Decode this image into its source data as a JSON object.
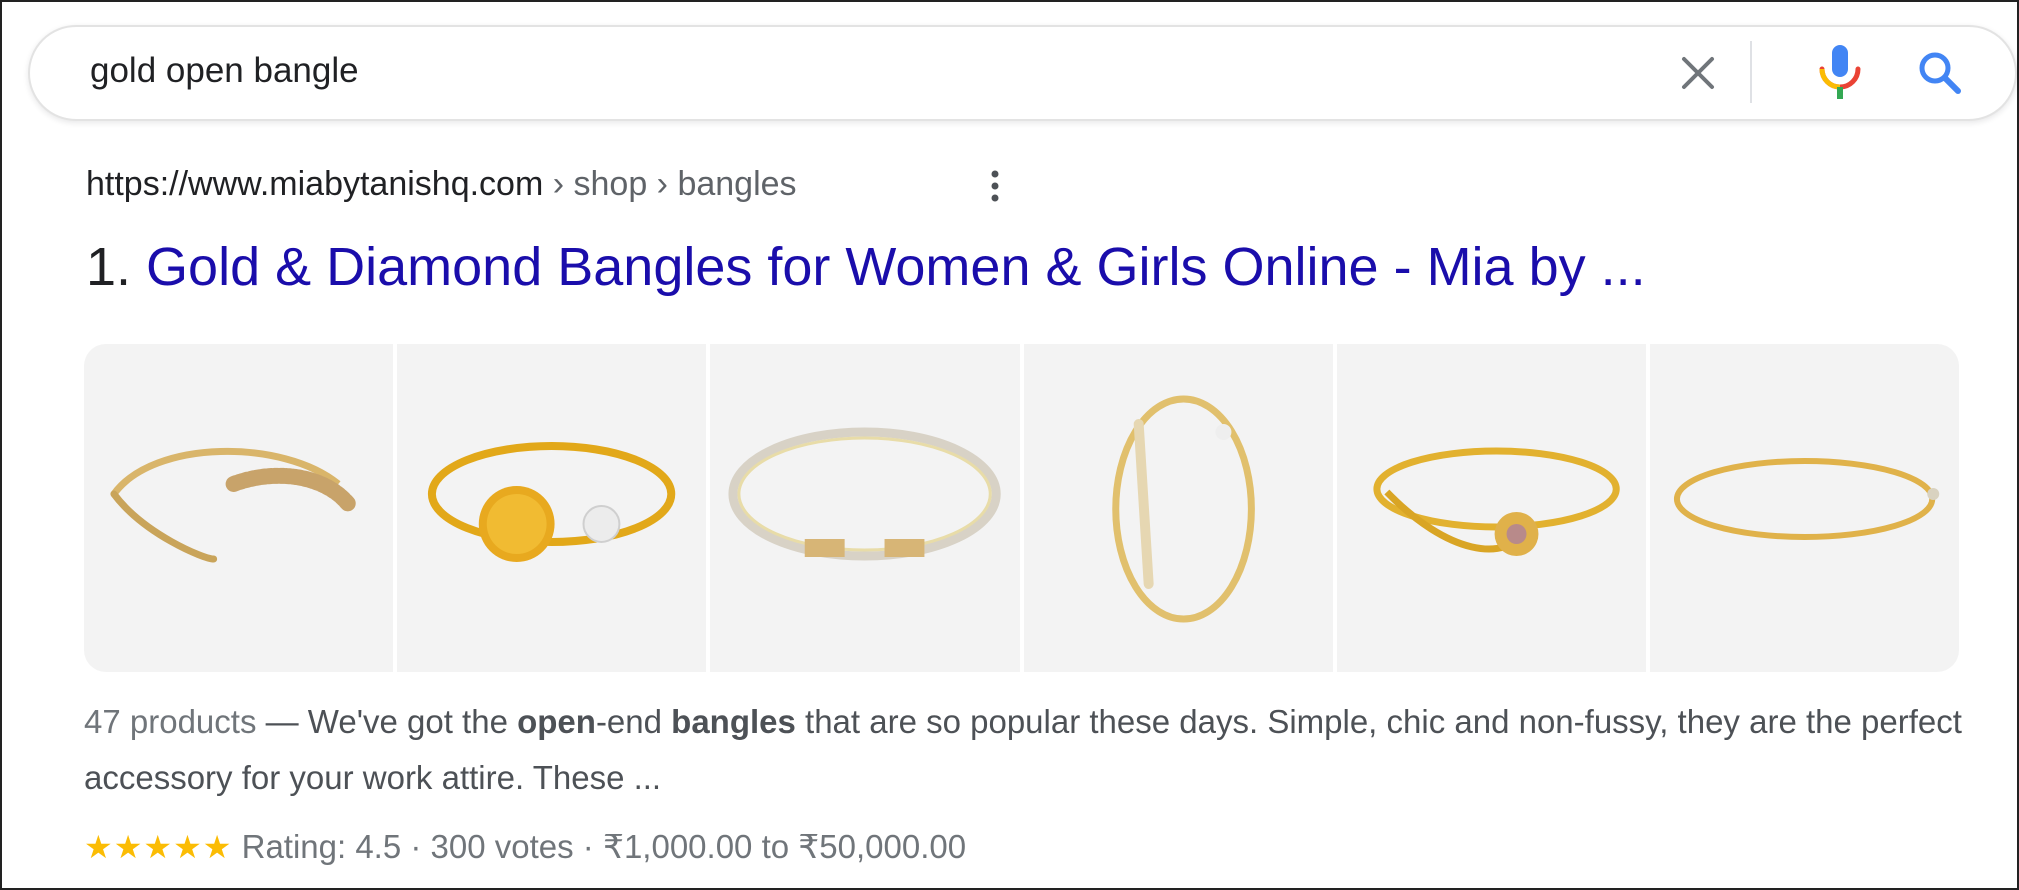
{
  "search": {
    "query": "gold open bangle"
  },
  "icons": {
    "clear": "close-icon",
    "mic": "microphone-icon",
    "search": "search-icon",
    "more": "more-vert-icon",
    "star": "star-icon"
  },
  "colors": {
    "link": "#1a0dab",
    "star": "#fbbc04",
    "search_blue": "#4285f4",
    "mic_red": "#ea4335",
    "mic_blue": "#4285f4",
    "mic_yellow": "#fbbc04",
    "mic_green": "#34a853"
  },
  "result": {
    "url_domain": "https://www.miabytanishq.com",
    "url_crumbs": " › shop › bangles",
    "number": "1. ",
    "title": "Gold & Diamond Bangles for Women & Girls Online - Mia by ...",
    "images": [
      {
        "name": "product-image-1"
      },
      {
        "name": "product-image-2"
      },
      {
        "name": "product-image-3"
      },
      {
        "name": "product-image-4"
      },
      {
        "name": "product-image-5"
      },
      {
        "name": "product-image-6"
      }
    ],
    "snippet_meta": "47 products",
    "snippet_dash": " — We've got the ",
    "snippet_bold_1": "open",
    "snippet_text_1": "-end ",
    "snippet_bold_2": "bangles",
    "snippet_text_2": " that are so popular these days. Simple, chic and non-fussy, they are the perfect accessory for your work attire. These ...",
    "stars": "★★★★★",
    "rating_text": " Rating: 4.5 · 300 votes · ₹1,000.00 to ₹50,000.00",
    "rating_value": 4.5
  }
}
